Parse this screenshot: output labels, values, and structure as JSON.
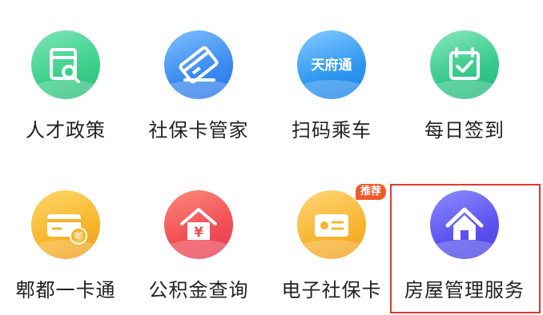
{
  "grid": {
    "items": [
      {
        "label": "人才政策",
        "icon": "document-search-icon",
        "color": "#3ccf8a"
      },
      {
        "label": "社保卡管家",
        "icon": "card-manager-icon",
        "color": "#3a8bf0"
      },
      {
        "label": "扫码乘车",
        "icon": "tianfutong-icon",
        "color": "#2f97f0",
        "icon_text": "天府通"
      },
      {
        "label": "每日签到",
        "icon": "calendar-check-icon",
        "color": "#34c98b"
      },
      {
        "label": "郫都一卡通",
        "icon": "pidu-card-icon",
        "color": "#f7b52b",
        "icon_text": "郫"
      },
      {
        "label": "公积金查询",
        "icon": "housing-fund-icon",
        "color": "#f04d55",
        "icon_text": "¥"
      },
      {
        "label": "电子社保卡",
        "icon": "e-social-card-icon",
        "color": "#f8b530",
        "badge": "推荐"
      },
      {
        "label": "房屋管理服务",
        "icon": "house-icon",
        "color": "#5b52ee"
      }
    ]
  },
  "highlight_color": "#e0382c"
}
